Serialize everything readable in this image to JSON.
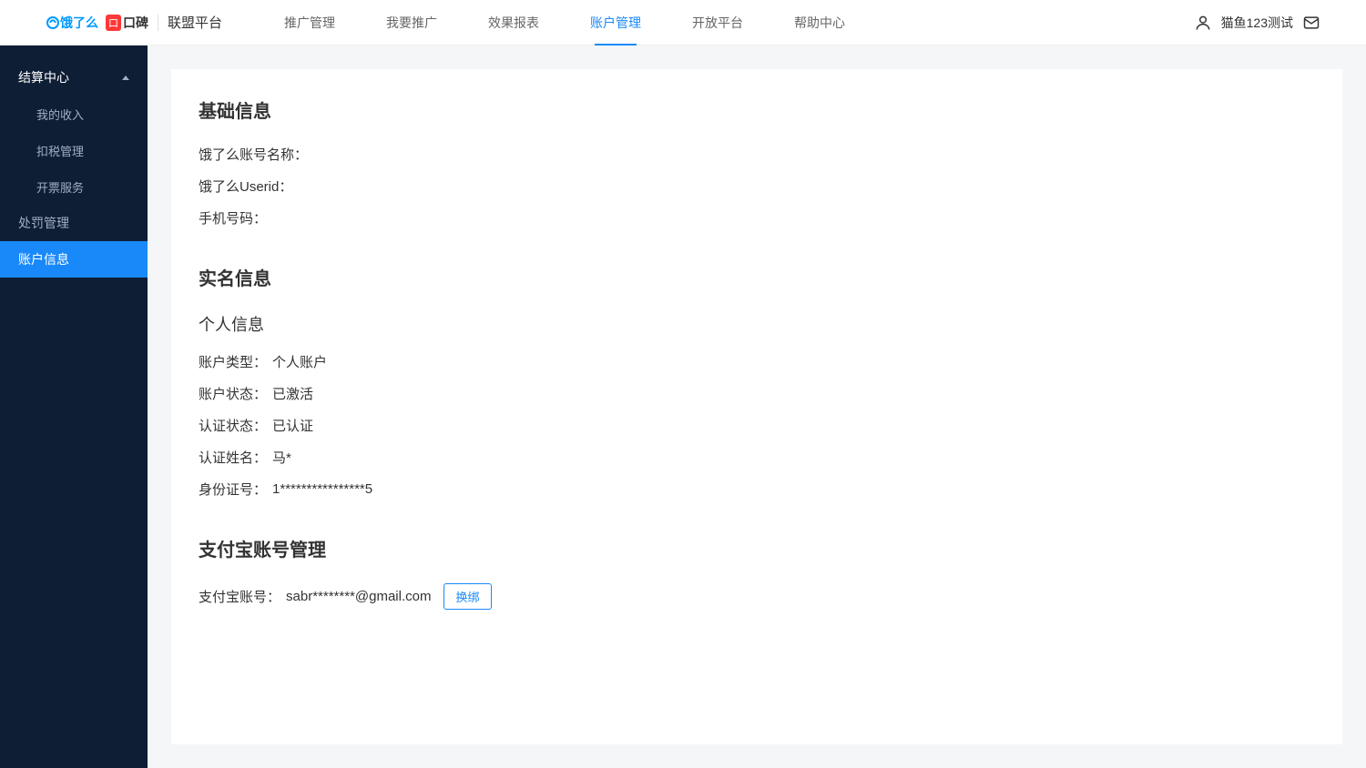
{
  "header": {
    "logo_eleme": "饿了么",
    "logo_koubei": "口碑",
    "logo_platform": "联盟平台",
    "nav": [
      {
        "label": "推广管理",
        "active": false
      },
      {
        "label": "我要推广",
        "active": false
      },
      {
        "label": "效果报表",
        "active": false
      },
      {
        "label": "账户管理",
        "active": true
      },
      {
        "label": "开放平台",
        "active": false
      },
      {
        "label": "帮助中心",
        "active": false
      }
    ],
    "username": "猫鱼123测试"
  },
  "sidebar": {
    "group": {
      "title": "结算中心",
      "items": [
        "我的收入",
        "扣税管理",
        "开票服务"
      ]
    },
    "items": [
      {
        "label": "处罚管理",
        "active": false
      },
      {
        "label": "账户信息",
        "active": true
      }
    ]
  },
  "content": {
    "basic": {
      "title": "基础信息",
      "rows": [
        {
          "label": "饿了么账号名称：",
          "value": ""
        },
        {
          "label": "饿了么Userid：",
          "value": ""
        },
        {
          "label": "手机号码：",
          "value": ""
        }
      ]
    },
    "realname": {
      "title": "实名信息",
      "personal": {
        "title": "个人信息",
        "rows": [
          {
            "label": "账户类型：",
            "value": "个人账户"
          },
          {
            "label": "账户状态：",
            "value": "已激活"
          },
          {
            "label": "认证状态：",
            "value": "已认证"
          },
          {
            "label": "认证姓名：",
            "value": "马*"
          },
          {
            "label": "身份证号：",
            "value": "1****************5"
          }
        ]
      }
    },
    "alipay": {
      "title": "支付宝账号管理",
      "label": "支付宝账号：",
      "value": "sabr********@gmail.com",
      "rebind_btn": "换绑"
    }
  }
}
